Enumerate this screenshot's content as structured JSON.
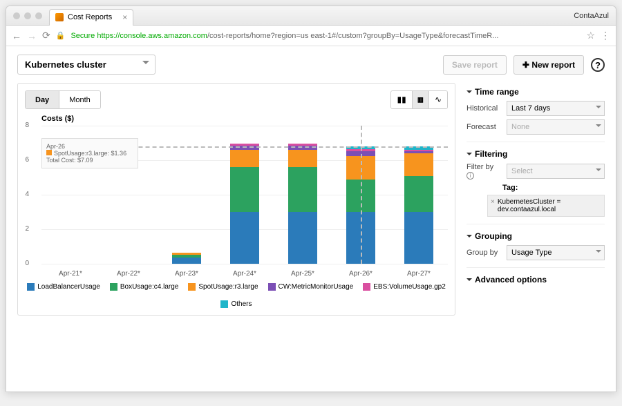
{
  "browser": {
    "tab_title": "Cost Reports",
    "profile": "ContaAzul",
    "secure_label": "Secure",
    "host": "https://console.aws.amazon.com",
    "path": "/cost-reports/home?region=us east-1#/custom?groupBy=UsageType&forecastTimeR..."
  },
  "header": {
    "report_name": "Kubernetes cluster",
    "save_label": "Save report",
    "new_label": "New report"
  },
  "tabs": {
    "day": "Day",
    "month": "Month"
  },
  "chart_data": {
    "type": "bar",
    "title": "Costs ($)",
    "ylabel": "",
    "ylim": [
      0,
      8
    ],
    "yticks": [
      0,
      2,
      4,
      6,
      8
    ],
    "reference_line": 6.8,
    "highlight_index": 5,
    "categories": [
      "Apr-21*",
      "Apr-22*",
      "Apr-23*",
      "Apr-24*",
      "Apr-25*",
      "Apr-26*",
      "Apr-27*"
    ],
    "series": [
      {
        "name": "LoadBalancerUsage",
        "color": "#2b7bba",
        "values": [
          0,
          0,
          0.35,
          3.0,
          3.0,
          3.0,
          3.0
        ]
      },
      {
        "name": "BoxUsage:c4.large",
        "color": "#2ca25f",
        "values": [
          0,
          0,
          0.18,
          2.6,
          2.6,
          1.9,
          2.1
        ]
      },
      {
        "name": "SpotUsage:r3.large",
        "color": "#f7941e",
        "values": [
          0,
          0,
          0.1,
          1.0,
          1.0,
          1.36,
          1.3
        ]
      },
      {
        "name": "CW:MetricMonitorUsage",
        "color": "#7b4fb5",
        "values": [
          0,
          0,
          0.02,
          0.25,
          0.25,
          0.25,
          0.12
        ]
      },
      {
        "name": "EBS:VolumeUsage.gp2",
        "color": "#d94fa0",
        "values": [
          0,
          0,
          0,
          0.1,
          0.1,
          0.15,
          0.1
        ]
      },
      {
        "name": "Others",
        "color": "#1fb5c9",
        "values": [
          0,
          0,
          0,
          0,
          0,
          0.15,
          0.18
        ]
      }
    ],
    "tooltip": {
      "date": "Apr-26",
      "item_label": "SpotUsage:r3.large: $1.36",
      "total_label": "Total Cost: $7.09"
    }
  },
  "sidebar": {
    "time_range": {
      "title": "Time range",
      "historical": "Historical",
      "historical_val": "Last 7 days",
      "forecast": "Forecast",
      "forecast_val": "None"
    },
    "filtering": {
      "title": "Filtering",
      "filter_by": "Filter by",
      "select": "Select",
      "tag_label": "Tag:",
      "tag_value": "KubernetesCluster = dev.contaazul.local"
    },
    "grouping": {
      "title": "Grouping",
      "group_by": "Group by",
      "value": "Usage Type"
    },
    "advanced": {
      "title": "Advanced options"
    }
  }
}
